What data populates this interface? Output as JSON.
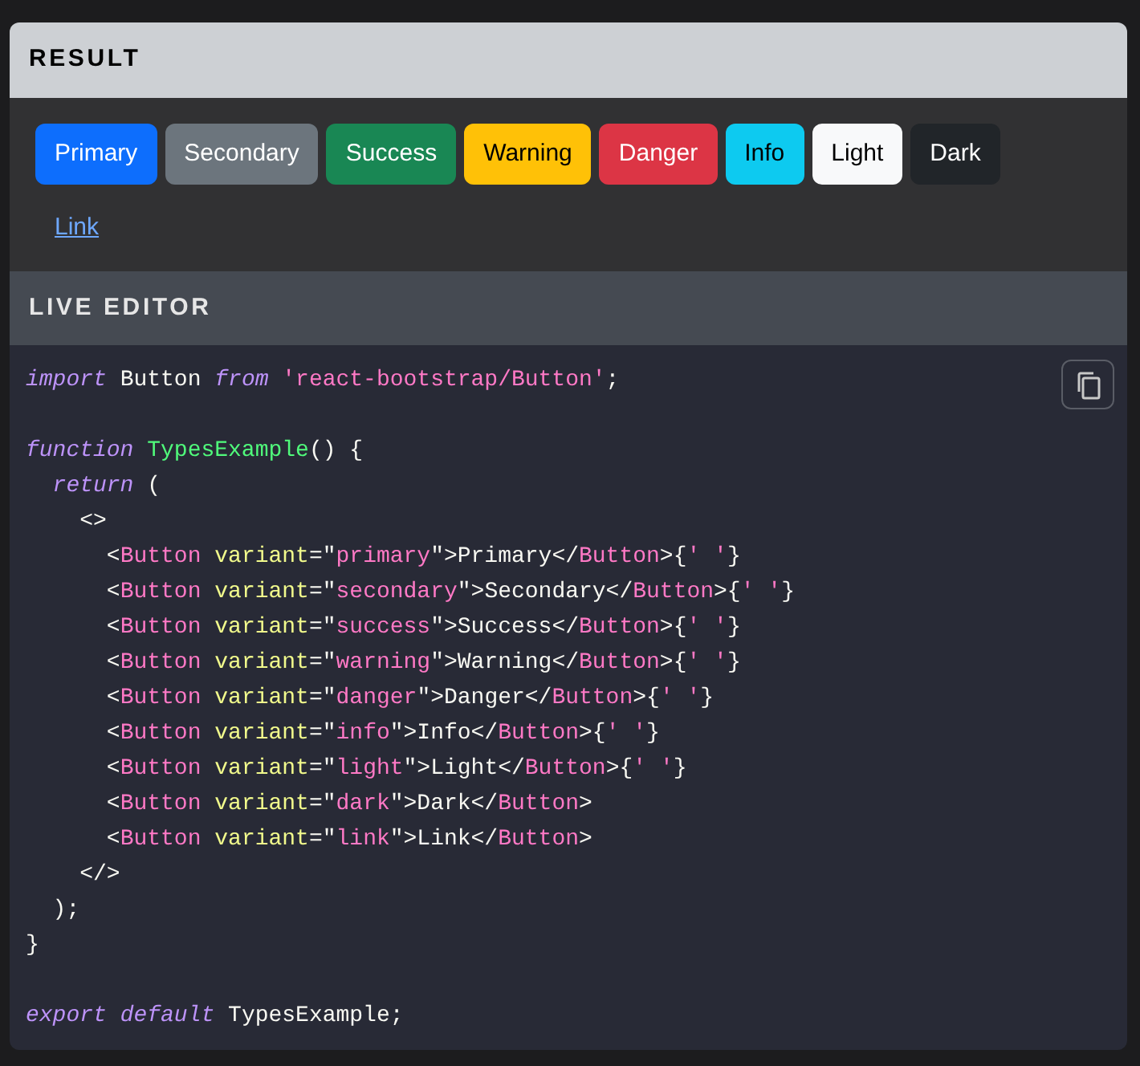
{
  "result": {
    "title": "RESULT",
    "buttons": [
      {
        "label": "Primary",
        "kind": "primary"
      },
      {
        "label": "Secondary",
        "kind": "secondary"
      },
      {
        "label": "Success",
        "kind": "success"
      },
      {
        "label": "Warning",
        "kind": "warning"
      },
      {
        "label": "Danger",
        "kind": "danger"
      },
      {
        "label": "Info",
        "kind": "info"
      },
      {
        "label": "Light",
        "kind": "light"
      },
      {
        "label": "Dark",
        "kind": "dark"
      },
      {
        "label": "Link",
        "kind": "link"
      }
    ]
  },
  "live_editor": {
    "title": "LIVE EDITOR",
    "code_lines": [
      {
        "tokens": [
          {
            "kind": "keyword",
            "text": "import"
          },
          {
            "kind": "plain",
            "text": " Button "
          },
          {
            "kind": "keyword",
            "text": "from"
          },
          {
            "kind": "string",
            "text": " 'react-bootstrap/Button'"
          },
          {
            "kind": "plain",
            "text": ";"
          }
        ]
      },
      {
        "gap_before": true,
        "tokens": [
          {
            "kind": "keyword",
            "text": "function"
          },
          {
            "kind": "func",
            "text": " TypesExample"
          },
          {
            "kind": "plain",
            "text": "() {"
          }
        ]
      },
      {
        "tokens": [
          {
            "kind": "keyword",
            "text": "  return"
          },
          {
            "kind": "plain",
            "text": " ("
          }
        ]
      },
      {
        "tokens": [
          {
            "kind": "plain",
            "text": "    <>"
          }
        ]
      },
      {
        "tokens": [
          {
            "kind": "plain",
            "text": "      <"
          },
          {
            "kind": "tag",
            "text": "Button"
          },
          {
            "kind": "attr",
            "text": " variant"
          },
          {
            "kind": "plain",
            "text": "=\""
          },
          {
            "kind": "string",
            "text": "primary"
          },
          {
            "kind": "plain",
            "text": "\">Primary</"
          },
          {
            "kind": "tag",
            "text": "Button"
          },
          {
            "kind": "plain",
            "text": ">{"
          },
          {
            "kind": "string",
            "text": "' '"
          },
          {
            "kind": "plain",
            "text": "}"
          }
        ]
      },
      {
        "tokens": [
          {
            "kind": "plain",
            "text": "      <"
          },
          {
            "kind": "tag",
            "text": "Button"
          },
          {
            "kind": "attr",
            "text": " variant"
          },
          {
            "kind": "plain",
            "text": "=\""
          },
          {
            "kind": "string",
            "text": "secondary"
          },
          {
            "kind": "plain",
            "text": "\">Secondary</"
          },
          {
            "kind": "tag",
            "text": "Button"
          },
          {
            "kind": "plain",
            "text": ">{"
          },
          {
            "kind": "string",
            "text": "' '"
          },
          {
            "kind": "plain",
            "text": "}"
          }
        ]
      },
      {
        "tokens": [
          {
            "kind": "plain",
            "text": "      <"
          },
          {
            "kind": "tag",
            "text": "Button"
          },
          {
            "kind": "attr",
            "text": " variant"
          },
          {
            "kind": "plain",
            "text": "=\""
          },
          {
            "kind": "string",
            "text": "success"
          },
          {
            "kind": "plain",
            "text": "\">Success</"
          },
          {
            "kind": "tag",
            "text": "Button"
          },
          {
            "kind": "plain",
            "text": ">{"
          },
          {
            "kind": "string",
            "text": "' '"
          },
          {
            "kind": "plain",
            "text": "}"
          }
        ]
      },
      {
        "tokens": [
          {
            "kind": "plain",
            "text": "      <"
          },
          {
            "kind": "tag",
            "text": "Button"
          },
          {
            "kind": "attr",
            "text": " variant"
          },
          {
            "kind": "plain",
            "text": "=\""
          },
          {
            "kind": "string",
            "text": "warning"
          },
          {
            "kind": "plain",
            "text": "\">Warning</"
          },
          {
            "kind": "tag",
            "text": "Button"
          },
          {
            "kind": "plain",
            "text": ">{"
          },
          {
            "kind": "string",
            "text": "' '"
          },
          {
            "kind": "plain",
            "text": "}"
          }
        ]
      },
      {
        "tokens": [
          {
            "kind": "plain",
            "text": "      <"
          },
          {
            "kind": "tag",
            "text": "Button"
          },
          {
            "kind": "attr",
            "text": " variant"
          },
          {
            "kind": "plain",
            "text": "=\""
          },
          {
            "kind": "string",
            "text": "danger"
          },
          {
            "kind": "plain",
            "text": "\">Danger</"
          },
          {
            "kind": "tag",
            "text": "Button"
          },
          {
            "kind": "plain",
            "text": ">{"
          },
          {
            "kind": "string",
            "text": "' '"
          },
          {
            "kind": "plain",
            "text": "}"
          }
        ]
      },
      {
        "tokens": [
          {
            "kind": "plain",
            "text": "      <"
          },
          {
            "kind": "tag",
            "text": "Button"
          },
          {
            "kind": "attr",
            "text": " variant"
          },
          {
            "kind": "plain",
            "text": "=\""
          },
          {
            "kind": "string",
            "text": "info"
          },
          {
            "kind": "plain",
            "text": "\">Info</"
          },
          {
            "kind": "tag",
            "text": "Button"
          },
          {
            "kind": "plain",
            "text": ">{"
          },
          {
            "kind": "string",
            "text": "' '"
          },
          {
            "kind": "plain",
            "text": "}"
          }
        ]
      },
      {
        "tokens": [
          {
            "kind": "plain",
            "text": "      <"
          },
          {
            "kind": "tag",
            "text": "Button"
          },
          {
            "kind": "attr",
            "text": " variant"
          },
          {
            "kind": "plain",
            "text": "=\""
          },
          {
            "kind": "string",
            "text": "light"
          },
          {
            "kind": "plain",
            "text": "\">Light</"
          },
          {
            "kind": "tag",
            "text": "Button"
          },
          {
            "kind": "plain",
            "text": ">{"
          },
          {
            "kind": "string",
            "text": "' '"
          },
          {
            "kind": "plain",
            "text": "}"
          }
        ]
      },
      {
        "tokens": [
          {
            "kind": "plain",
            "text": "      <"
          },
          {
            "kind": "tag",
            "text": "Button"
          },
          {
            "kind": "attr",
            "text": " variant"
          },
          {
            "kind": "plain",
            "text": "=\""
          },
          {
            "kind": "string",
            "text": "dark"
          },
          {
            "kind": "plain",
            "text": "\">Dark</"
          },
          {
            "kind": "tag",
            "text": "Button"
          },
          {
            "kind": "plain",
            "text": ">"
          }
        ]
      },
      {
        "tokens": [
          {
            "kind": "plain",
            "text": "      <"
          },
          {
            "kind": "tag",
            "text": "Button"
          },
          {
            "kind": "attr",
            "text": " variant"
          },
          {
            "kind": "plain",
            "text": "=\""
          },
          {
            "kind": "string",
            "text": "link"
          },
          {
            "kind": "plain",
            "text": "\">Link</"
          },
          {
            "kind": "tag",
            "text": "Button"
          },
          {
            "kind": "plain",
            "text": ">"
          }
        ]
      },
      {
        "tokens": [
          {
            "kind": "plain",
            "text": "    </>"
          }
        ]
      },
      {
        "tokens": [
          {
            "kind": "plain",
            "text": "  );"
          }
        ]
      },
      {
        "tokens": [
          {
            "kind": "plain",
            "text": "}"
          }
        ]
      },
      {
        "gap_before": true,
        "tokens": [
          {
            "kind": "keyword",
            "text": "export"
          },
          {
            "kind": "keyword",
            "text": " default"
          },
          {
            "kind": "plain",
            "text": " TypesExample;"
          }
        ]
      }
    ]
  }
}
